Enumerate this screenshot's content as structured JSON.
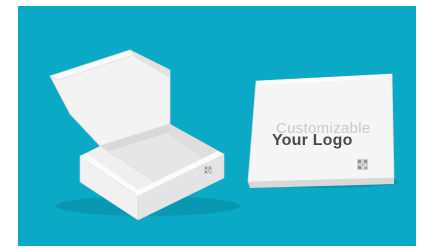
{
  "scene": {
    "description_colors": {
      "background": "#0aaac6",
      "box_white": "#f4f4f4",
      "box_shade": "#dcdcdc",
      "box_inner": "#e9e9e9"
    },
    "closed_box": {
      "logo_text": "Your Logo",
      "watermark_text": "Customizable",
      "qr_icon": "qr-code-icon"
    },
    "open_box": {
      "qr_icon": "qr-code-icon"
    }
  }
}
